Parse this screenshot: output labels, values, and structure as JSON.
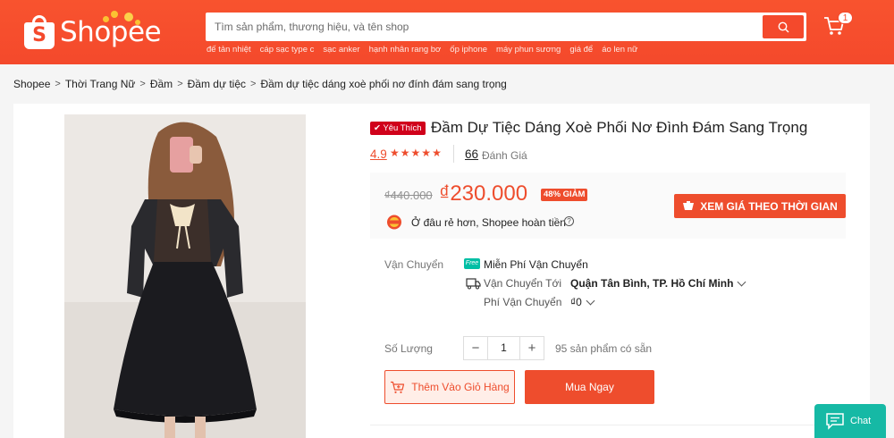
{
  "header": {
    "logo_text": "Shopee",
    "search_placeholder": "Tìm sản phẩm, thương hiệu, và tên shop",
    "suggestions": [
      "đế tản nhiệt",
      "cáp sạc type c",
      "sạc anker",
      "hạnh nhân rang bơ",
      "ốp iphone",
      "máy phun sương",
      "giá để",
      "áo len nữ"
    ],
    "cart_count": "1"
  },
  "breadcrumb": [
    "Shopee",
    "Thời Trang Nữ",
    "Đầm",
    "Đầm dự tiệc",
    "Đầm dự tiệc dáng xoè phối nơ đính đám sang trọng"
  ],
  "product": {
    "badge": "Yêu Thích",
    "title": "Đầm Dự Tiệc Dáng Xoè Phối Nơ Đình Đám Sang Trọng",
    "rating": "4.9",
    "rating_value": 4.9,
    "review_count": "66",
    "review_label": "Đánh Giá",
    "old_price": "₫440.000",
    "price": "₫230.000",
    "discount": "48% GIẢM",
    "price_timeline_button": "XEM GIÁ THEO THỜI GIAN",
    "guarantee_text": "Ở đâu rẻ hơn, Shopee hoàn tiền",
    "shipping": {
      "label": "Vận Chuyển",
      "free_icon": "Free",
      "free_text": "Miễn Phí Vận Chuyển",
      "to_label": "Vận Chuyển Tới",
      "to_value": "Quận Tân Bình, TP. Hồ Chí Minh",
      "fee_label": "Phí Vận Chuyển",
      "fee_value": "₫0"
    },
    "quantity": {
      "label": "Số Lượng",
      "minus": "−",
      "value": "1",
      "plus": "+",
      "stock": "95 sản phẩm có sẵn"
    },
    "add_to_cart": "Thêm Vào Giỏ Hàng",
    "buy_now": "Mua Ngay"
  },
  "chat": {
    "label": "Chat"
  },
  "colors": {
    "brand": "#ee4d2d",
    "header": "#f4492c",
    "chat": "#16b9a5",
    "free_ship": "#00bfa5"
  }
}
